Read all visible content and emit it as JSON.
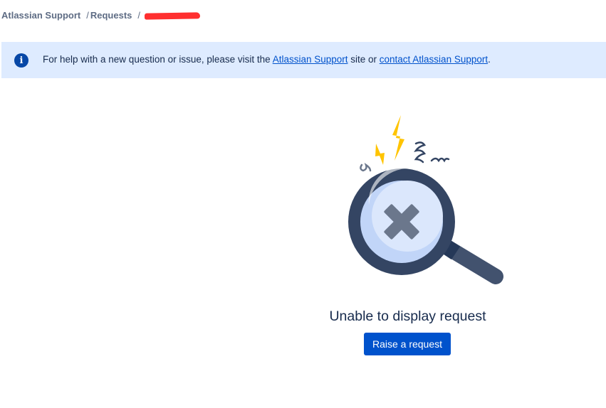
{
  "breadcrumb": {
    "items": [
      "Atlassian Support",
      "Requests"
    ],
    "separator": "/"
  },
  "info": {
    "icon": "info-icon",
    "text_before": "For help with a new question or issue, please visit the ",
    "link1": "Atlassian Support",
    "text_middle": " site or ",
    "link2": "contact Atlassian Support",
    "text_after": "."
  },
  "empty_state": {
    "illustration": "magnifier-x-icon",
    "title": "Unable to display request",
    "button": "Raise a request"
  },
  "colors": {
    "banner_bg": "#deebff",
    "info_icon": "#0747a6",
    "link": "#0052cc",
    "button_bg": "#0052cc",
    "redaction": "#ff2f2f"
  }
}
